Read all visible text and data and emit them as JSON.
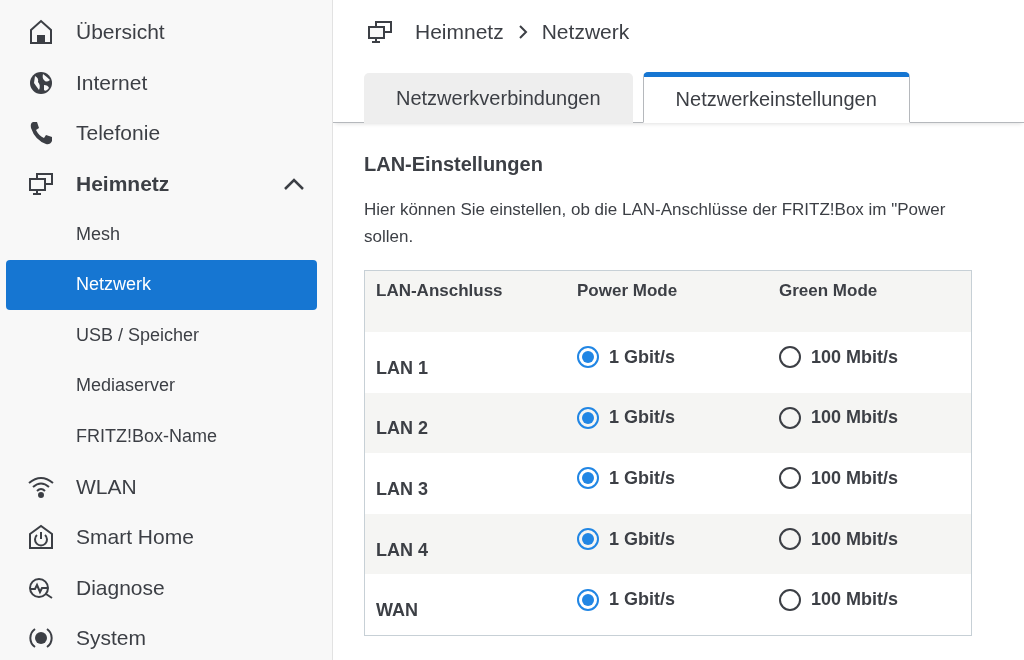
{
  "sidebar": {
    "items": [
      {
        "label": "Übersicht",
        "selected": false
      },
      {
        "label": "Internet",
        "selected": false
      },
      {
        "label": "Telefonie",
        "selected": false
      },
      {
        "label": "Heimnetz",
        "selected": false,
        "expanded": true,
        "children": [
          {
            "label": "Mesh",
            "selected": false
          },
          {
            "label": "Netzwerk",
            "selected": true
          },
          {
            "label": "USB / Speicher",
            "selected": false
          },
          {
            "label": "Mediaserver",
            "selected": false
          },
          {
            "label": "FRITZ!Box-Name",
            "selected": false
          }
        ]
      },
      {
        "label": "WLAN",
        "selected": false
      },
      {
        "label": "Smart Home",
        "selected": false
      },
      {
        "label": "Diagnose",
        "selected": false
      },
      {
        "label": "System",
        "selected": false
      }
    ]
  },
  "breadcrumb": [
    "Heimnetz",
    "Netzwerk"
  ],
  "tabs": [
    {
      "label": "Netzwerkverbindungen",
      "selected": false
    },
    {
      "label": "Netzwerkeinstellungen",
      "selected": true
    }
  ],
  "section": {
    "title": "LAN-Einstellungen",
    "description_lines": [
      "Hier können Sie einstellen, ob die LAN-Anschlüsse der FRITZ!Box im \"Power",
      "sollen."
    ]
  },
  "table": {
    "columns": [
      "LAN-Anschluss",
      "Power Mode",
      "Green Mode"
    ],
    "rows": [
      {
        "port": "LAN 1",
        "options": [
          {
            "label": "1 Gbit/s",
            "selected": true
          },
          {
            "label": "100 Mbit/s",
            "selected": false
          }
        ]
      },
      {
        "port": "LAN 2",
        "options": [
          {
            "label": "1 Gbit/s",
            "selected": true
          },
          {
            "label": "100 Mbit/s",
            "selected": false
          }
        ]
      },
      {
        "port": "LAN 3",
        "options": [
          {
            "label": "1 Gbit/s",
            "selected": true
          },
          {
            "label": "100 Mbit/s",
            "selected": false
          }
        ]
      },
      {
        "port": "LAN 4",
        "options": [
          {
            "label": "1 Gbit/s",
            "selected": true
          },
          {
            "label": "100 Mbit/s",
            "selected": false
          }
        ]
      },
      {
        "port": "WAN",
        "options": [
          {
            "label": "1 Gbit/s",
            "selected": true
          },
          {
            "label": "100 Mbit/s",
            "selected": false
          }
        ]
      }
    ]
  }
}
